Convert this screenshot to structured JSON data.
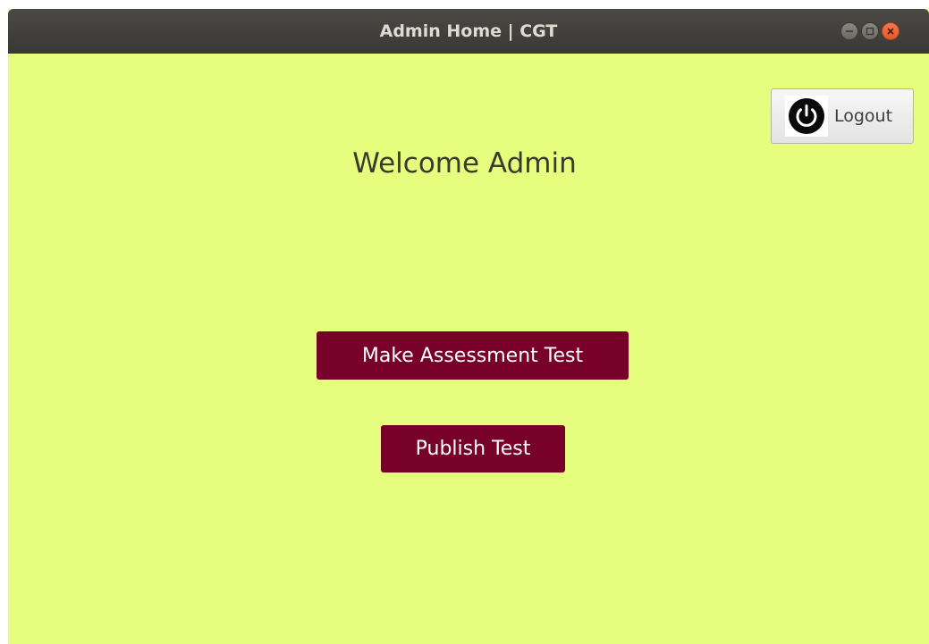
{
  "window": {
    "title": "Admin Home | CGT"
  },
  "header": {
    "logout_label": "Logout",
    "welcome_text": "Welcome Admin"
  },
  "actions": {
    "make_assessment_label": "Make Assessment Test",
    "publish_test_label": "Publish Test"
  },
  "colors": {
    "background": "#e6fd7e",
    "button": "#780129",
    "button_text": "#ffffff",
    "titlebar": "#3e3d39"
  },
  "icons": {
    "logout": "power-icon",
    "minimize": "minimize-icon",
    "maximize": "maximize-icon",
    "close": "close-icon"
  }
}
